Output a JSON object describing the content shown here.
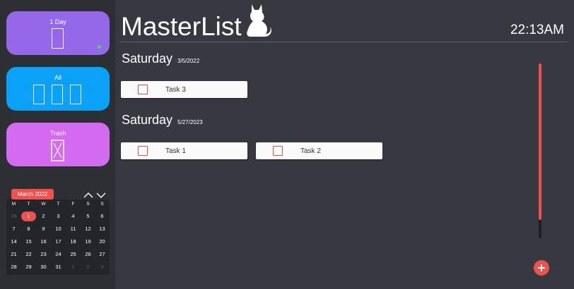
{
  "sidebar": {
    "cards": [
      {
        "label": "1 Day",
        "accent": "#9468e8",
        "icon": "single-page-icon"
      },
      {
        "label": "All",
        "accent": "#0aa2f8",
        "icon": "three-pages-icon"
      },
      {
        "label": "Trash",
        "accent": "#d46af0",
        "icon": "trash-page-icon"
      }
    ],
    "calendar": {
      "month": "March 2022",
      "weekdays": [
        "M",
        "T",
        "W",
        "T",
        "F",
        "S",
        "S"
      ],
      "weeks": [
        [
          "28",
          "1",
          "2",
          "3",
          "4",
          "5",
          "6"
        ],
        [
          "7",
          "8",
          "9",
          "10",
          "11",
          "12",
          "13"
        ],
        [
          "14",
          "15",
          "16",
          "17",
          "18",
          "19",
          "20"
        ],
        [
          "21",
          "22",
          "23",
          "24",
          "25",
          "26",
          "27"
        ],
        [
          "28",
          "29",
          "30",
          "31",
          "1",
          "2",
          "3"
        ]
      ],
      "selected": "1"
    }
  },
  "header": {
    "title": "MasterList",
    "logo_icon": "cat-icon",
    "clock": "22:13AM"
  },
  "groups": [
    {
      "day": "Saturday",
      "date": "3/5/2022",
      "tasks": [
        {
          "label": "Task 3"
        }
      ]
    },
    {
      "day": "Saturday",
      "date": "5/27/2023",
      "tasks": [
        {
          "label": "Task 1"
        },
        {
          "label": "Task 2"
        }
      ]
    }
  ],
  "add_button": {
    "icon": "plus-icon"
  },
  "colors": {
    "accent": "#f0504e",
    "background": "#363a40",
    "sidebar": "#2c2f34"
  }
}
